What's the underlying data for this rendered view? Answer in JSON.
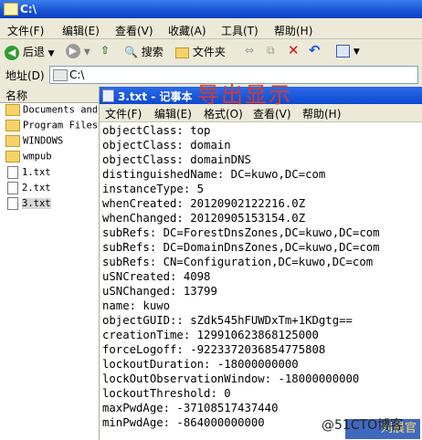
{
  "explorer": {
    "title": "C:\\",
    "menus": [
      "文件(F)",
      "编辑(E)",
      "查看(V)",
      "收藏(A)",
      "工具(T)",
      "帮助(H)"
    ],
    "toolbar": {
      "back": "后退",
      "search": "搜索",
      "folders": "文件夹"
    },
    "address": {
      "label": "地址(D)",
      "value": "C:\\"
    },
    "tree": {
      "header": "名称",
      "items": [
        {
          "label": "Documents and",
          "kind": "folder"
        },
        {
          "label": "Program Files",
          "kind": "folder"
        },
        {
          "label": "WINDOWS",
          "kind": "folder"
        },
        {
          "label": "wmpub",
          "kind": "folder"
        },
        {
          "label": "1.txt",
          "kind": "file"
        },
        {
          "label": "2.txt",
          "kind": "file"
        },
        {
          "label": "3.txt",
          "kind": "file",
          "selected": true
        }
      ]
    }
  },
  "notepad": {
    "title": "3.txt - 记事本",
    "menus": [
      "文件(F)",
      "编辑(E)",
      "格式(O)",
      "查看(V)",
      "帮助(H)"
    ],
    "lines": [
      "objectClass: top",
      "objectClass: domain",
      "objectClass: domainDNS",
      "distinguishedName: DC=kuwo,DC=com",
      "instanceType: 5",
      "whenCreated: 20120902122216.0Z",
      "whenChanged: 20120905153154.0Z",
      "subRefs: DC=ForestDnsZones,DC=kuwo,DC=com",
      "subRefs: DC=DomainDnsZones,DC=kuwo,DC=com",
      "subRefs: CN=Configuration,DC=kuwo,DC=com",
      "uSNCreated: 4098",
      "uSNChanged: 13799",
      "name: kuwo",
      "objectGUID:: sZdk545hFUWDxTm+1KDgtg==",
      "creationTime: 129910623868125000",
      "forceLogoff: -9223372036854775808",
      "lockoutDuration: -18000000000",
      "lockOutObservationWindow: -18000000000",
      "lockoutThreshold: 0",
      "maxPwdAge: -37108517437440",
      "minPwdAge: -864000000000"
    ]
  },
  "overlay_text": "导出显示",
  "watermark": {
    "site": "@51CTO博客",
    "badge": "刘晨官"
  },
  "colors": {
    "title_blue": "#0a3fc0",
    "annotation_red": "#d93a2a"
  }
}
